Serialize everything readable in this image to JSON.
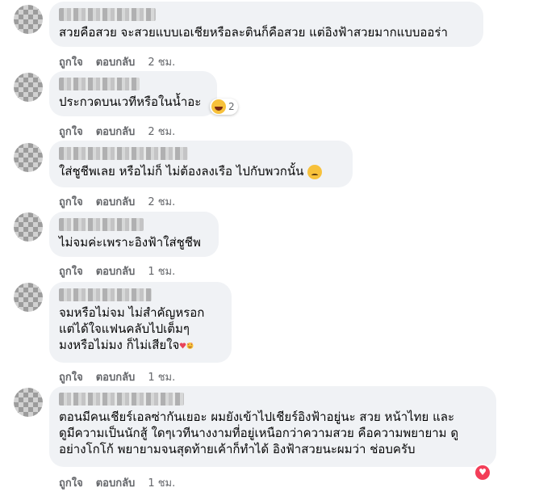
{
  "comments": [
    {
      "text": "สวยคือสวย จะสวยแบบเอเชียหรือละตินก็คือสวย แต่อิงฟ้าสวยมากแบบออร่า",
      "like": "ถูกใจ",
      "reply": "ตอบกลับ",
      "time": "2 ชม."
    },
    {
      "text": "ประกวดบนเวทีหรือในน้ำอะ",
      "like": "ถูกใจ",
      "reply": "ตอบกลับ",
      "time": "2 ชม.",
      "reaction_icon": "haha-emoji-icon",
      "reaction_count": "2"
    },
    {
      "text": "ใส่ชูชีพเลย หรือไม่ก็ ไม่ต้องลงเรือ ไปกับพวกนั้น",
      "like": "ถูกใจ",
      "reply": "ตอบกลับ",
      "time": "2 ชม.",
      "trailing_emoji": "sad-emoji-icon"
    },
    {
      "text": "ไม่จมค่ะเพราะอิงฟ้าใส่ชูชีพ",
      "like": "ถูกใจ",
      "reply": "ตอบกลับ",
      "time": "1 ชม."
    },
    {
      "text_lines": [
        "จมหรือไม่จม ไม่สำคัญหรอก",
        "แต่ได้ใจแฟนคลับไปเต็มๆ",
        "มงหรือไม่มง ก็ไม่เสียใจ"
      ],
      "like": "ถูกใจ",
      "reply": "ตอบกลับ",
      "time": "1 ชม.",
      "trailing_emoji": "heart-emoji-icon"
    },
    {
      "text_lines": [
        "ตอนมีคนเชียร์เอลซ่ากันเยอะ ผมยังเข้าไปเชียร์อิงฟ้าอยู่นะ สวย หน้าไทย และ",
        "ดูมีความเป็นนักสู้ ใดๆเวทีนางงามที่อยู่เหนือกว่าความสวย คือความพยายาม ดู",
        "อย่างโกโก้ พยายามจนสุดท้ายเค้าก็ทำได้ อิงฟ้าสวยนะผมว่า ช่อบครับ"
      ],
      "like": "ถูกใจ",
      "reply": "ตอบกลับ",
      "time": "1 ชม.",
      "reaction_icon": "love-reaction-icon"
    }
  ],
  "colors": {
    "bubble": "#f0f2f5",
    "meta": "#65676b",
    "text": "#050505",
    "love": "#f33e58"
  }
}
